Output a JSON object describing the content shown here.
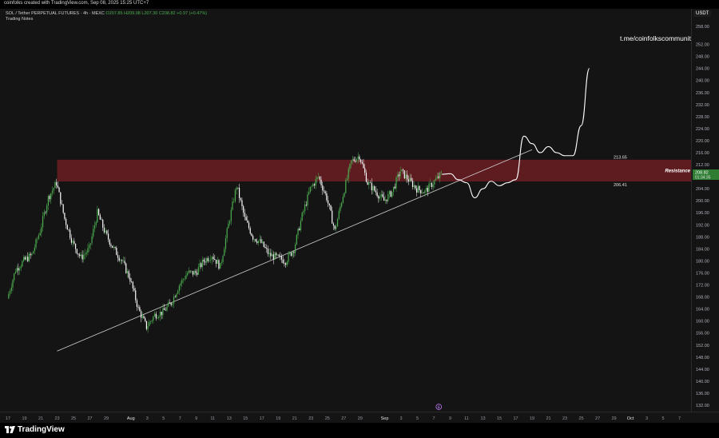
{
  "header": {
    "attribution": "coinfolks created with TradingView.com, Sep 08, 2025 15:25 UTC+7"
  },
  "legend": {
    "symbol_line": "SOL / Tether PERPETUAL FUTURES · 4h · MEXC",
    "open": "O207.85",
    "high": "H209.08",
    "low": "L207.30",
    "close": "C208.82",
    "change": "+0.97 (+0.47%)",
    "notes": "Trading Notes"
  },
  "watermark": "t.me/coinfolkscommunity",
  "currency_badge": "USDT",
  "footer": {
    "brand": "TradingView"
  },
  "colors": {
    "up": "#4caf50",
    "down": "#ffffff",
    "zone": "#6b1c22",
    "background": "#141414"
  },
  "chart_data": {
    "type": "candlestick",
    "symbol": "SOL / Tether PERPETUAL FUTURES",
    "timeframe": "4h",
    "exchange": "MEXC",
    "ylim": [
      130,
      260
    ],
    "y_ticks": [
      "258.00",
      "252.00",
      "248.00",
      "244.00",
      "240.00",
      "236.00",
      "232.00",
      "228.00",
      "224.00",
      "220.00",
      "216.00",
      "212.00",
      "208.00",
      "204.00",
      "200.00",
      "196.00",
      "192.00",
      "188.00",
      "184.00",
      "180.00",
      "176.00",
      "172.00",
      "168.00",
      "164.00",
      "160.00",
      "156.00",
      "152.00",
      "148.00",
      "144.00",
      "140.00",
      "136.00",
      "132.00"
    ],
    "x_ticks": [
      "17",
      "19",
      "21",
      "23",
      "25",
      "27",
      "29",
      "Aug",
      "3",
      "5",
      "7",
      "9",
      "11",
      "13",
      "15",
      "17",
      "19",
      "21",
      "23",
      "25",
      "27",
      "29",
      "Sep",
      "3",
      "5",
      "7",
      "9",
      "11",
      "13",
      "15",
      "17",
      "19",
      "21",
      "23",
      "25",
      "27",
      "29",
      "Oct",
      "3",
      "5",
      "7"
    ],
    "last_price": "208.82",
    "countdown": "01:34:35",
    "price_path": [
      [
        "Jul 17",
        167.5
      ],
      [
        "Jul 18",
        177
      ],
      [
        "Jul 19",
        180
      ],
      [
        "Jul 20",
        182
      ],
      [
        "Jul 21",
        190
      ],
      [
        "Jul 22",
        201
      ],
      [
        "Jul 23",
        206
      ],
      [
        "Jul 24",
        194
      ],
      [
        "Jul 25",
        186
      ],
      [
        "Jul 26",
        181
      ],
      [
        "Jul 27",
        184
      ],
      [
        "Jul 28",
        196
      ],
      [
        "Jul 29",
        189
      ],
      [
        "Jul 30",
        184
      ],
      [
        "Jul 31",
        180
      ],
      [
        "Aug 1",
        174
      ],
      [
        "Aug 2",
        164
      ],
      [
        "Aug 3",
        158
      ],
      [
        "Aug 4",
        162
      ],
      [
        "Aug 5",
        163
      ],
      [
        "Aug 6",
        166
      ],
      [
        "Aug 7",
        172
      ],
      [
        "Aug 8",
        176
      ],
      [
        "Aug 9",
        176
      ],
      [
        "Aug 10",
        180
      ],
      [
        "Aug 11",
        182
      ],
      [
        "Aug 12",
        178
      ],
      [
        "Aug 13",
        192
      ],
      [
        "Aug 14",
        205
      ],
      [
        "Aug 15",
        194
      ],
      [
        "Aug 16",
        188
      ],
      [
        "Aug 17",
        186
      ],
      [
        "Aug 18",
        182
      ],
      [
        "Aug 19",
        181
      ],
      [
        "Aug 20",
        180
      ],
      [
        "Aug 21",
        184
      ],
      [
        "Aug 22",
        195
      ],
      [
        "Aug 23",
        204
      ],
      [
        "Aug 24",
        208
      ],
      [
        "Aug 25",
        201
      ],
      [
        "Aug 26",
        190
      ],
      [
        "Aug 27",
        202
      ],
      [
        "Aug 28",
        213
      ],
      [
        "Aug 29",
        215
      ],
      [
        "Aug 30",
        206
      ],
      [
        "Aug 31",
        203
      ],
      [
        "Sep 1",
        200
      ],
      [
        "Sep 2",
        203
      ],
      [
        "Sep 3",
        210
      ],
      [
        "Sep 4",
        207
      ],
      [
        "Sep 5",
        204
      ],
      [
        "Sep 6",
        203
      ],
      [
        "Sep 7",
        206
      ],
      [
        "Sep 8",
        208.82
      ]
    ],
    "projection": [
      [
        "Sep 8",
        208.8
      ],
      [
        "Sep 9",
        209
      ],
      [
        "Sep 10",
        207
      ],
      [
        "Sep 11",
        206
      ],
      [
        "Sep 12",
        201
      ],
      [
        "Sep 13",
        204
      ],
      [
        "Sep 14",
        206.5
      ],
      [
        "Sep 15",
        205
      ],
      [
        "Sep 16",
        206
      ],
      [
        "Sep 17",
        207
      ],
      [
        "Sep 18",
        221.5
      ],
      [
        "Sep 19",
        219
      ],
      [
        "Sep 20",
        216
      ],
      [
        "Sep 21",
        218
      ],
      [
        "Sep 22",
        216
      ],
      [
        "Sep 23",
        215
      ],
      [
        "Sep 24",
        215
      ],
      [
        "Sep 25",
        225
      ],
      [
        "Sep 26",
        244
      ]
    ],
    "resistance_zone": {
      "label": "Resistance",
      "upper": 213.65,
      "lower": 206.41,
      "upper_label": "213.65",
      "lower_label": "206.41"
    },
    "trendline": {
      "from": [
        "Jul 23",
        150
      ],
      "to": [
        "Sep 19",
        217
      ]
    }
  }
}
